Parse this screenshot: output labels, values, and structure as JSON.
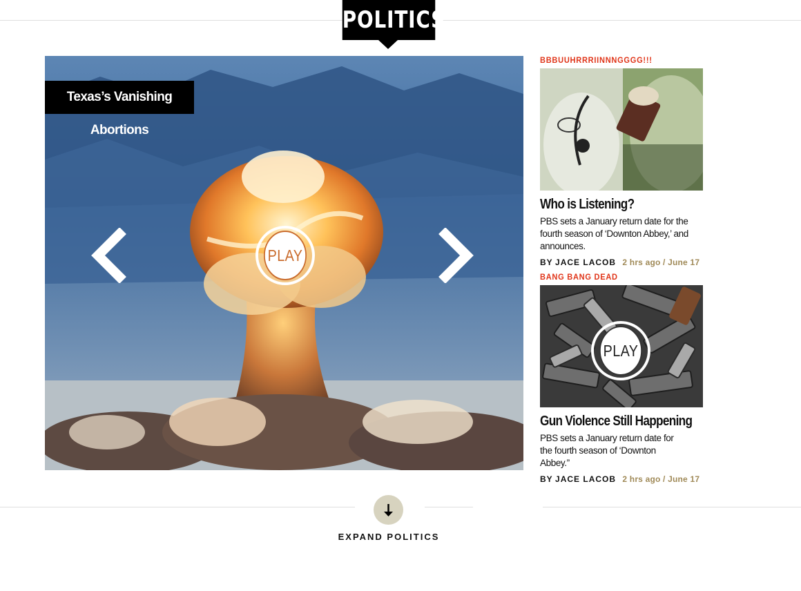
{
  "header": {
    "section_title": "POLITICS"
  },
  "hero": {
    "caption": "Texas’s Vanishing Abortions",
    "play_label": "PLAY",
    "prev_icon": "chevron-left-icon",
    "next_icon": "chevron-right-icon"
  },
  "stories": [
    {
      "kicker": "BBBUUHRRRIINNNGGGG!!!",
      "title": "Who is Listening?",
      "dek": "PBS sets a January return date for the fourth season of ‘Downton Abbey,’ and announces.",
      "byline_prefix": "BY",
      "author": "JACE LACOB",
      "time": "2 hrs ago / June 17"
    },
    {
      "kicker": "BANG BANG DEAD",
      "title": "Gun Violence Still Happening",
      "dek": "PBS sets a January return date for the fourth season of ‘Downton Abbey.”",
      "byline_prefix": "BY",
      "author": "JACE LACOB",
      "time": "2 hrs ago / June 17",
      "play_label": "PLAY"
    }
  ],
  "footer": {
    "expand_label": "EXPAND POLITICS",
    "expand_icon": "arrow-down-icon"
  },
  "colors": {
    "kicker": "#e03418",
    "meta": "#a08a58",
    "expand_button": "#d7d3bf"
  }
}
